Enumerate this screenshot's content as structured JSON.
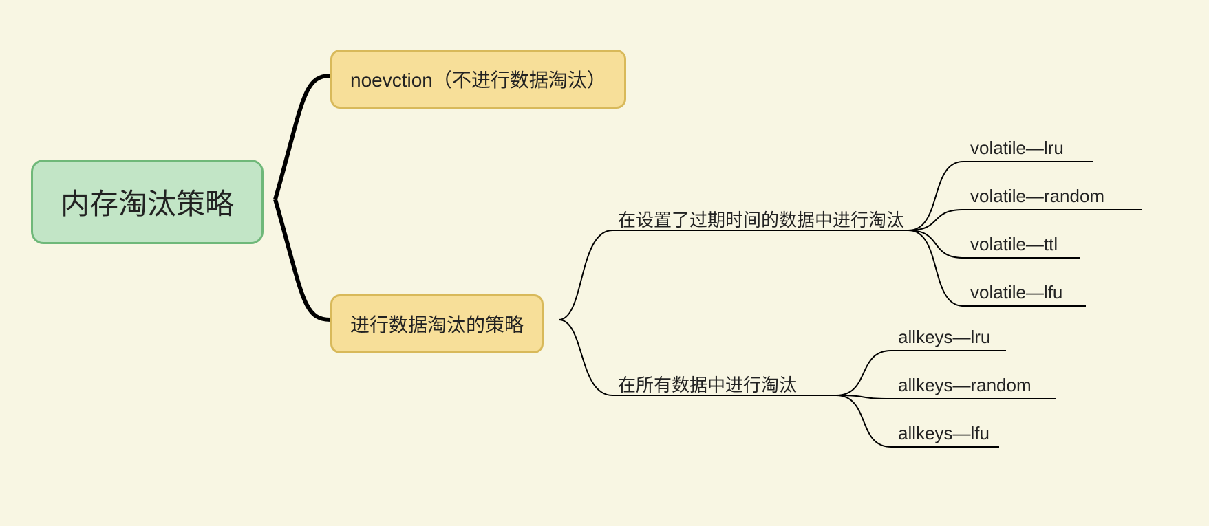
{
  "root": {
    "label": "内存淘汰策略"
  },
  "branches": {
    "noeviction": {
      "label": "noevction（不进行数据淘汰）"
    },
    "eviction": {
      "label": "进行数据淘汰的策略"
    }
  },
  "groups": {
    "volatile": {
      "label": "在设置了过期时间的数据中进行淘汰",
      "items": [
        "volatile—lru",
        "volatile—random",
        "volatile—ttl",
        "volatile—lfu"
      ]
    },
    "allkeys": {
      "label": "在所有数据中进行淘汰",
      "items": [
        "allkeys—lru",
        "allkeys—random",
        "allkeys—lfu"
      ]
    }
  },
  "colors": {
    "background": "#f8f6e3",
    "rootFill": "#c2e5c6",
    "rootBorder": "#6fb879",
    "branchFill": "#f7df99",
    "branchBorder": "#d8b95a"
  }
}
